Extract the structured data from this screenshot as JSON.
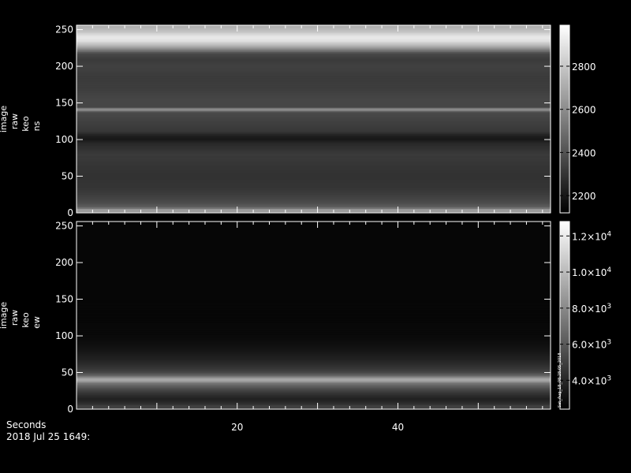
{
  "chart_data": [
    {
      "type": "heatmap",
      "name": "ns",
      "ylabel": [
        "image",
        "raw",
        "keo",
        "ns"
      ],
      "yticks": [
        0,
        50,
        100,
        150,
        200,
        250
      ],
      "ylim": [
        0,
        256
      ],
      "xlim": [
        0,
        59
      ],
      "colorbar": {
        "ticks": [
          2200,
          2400,
          2600,
          2800
        ],
        "tick_labels": [
          "2200",
          "2400",
          "2600",
          "2800"
        ],
        "range": [
          2120,
          2990
        ]
      },
      "row_profile": [
        [
          0,
          2540
        ],
        [
          4,
          2700
        ],
        [
          8,
          2450
        ],
        [
          14,
          2380
        ],
        [
          22,
          2340
        ],
        [
          35,
          2300
        ],
        [
          50,
          2290
        ],
        [
          65,
          2300
        ],
        [
          80,
          2320
        ],
        [
          95,
          2260
        ],
        [
          101,
          2200
        ],
        [
          106,
          2230
        ],
        [
          112,
          2310
        ],
        [
          125,
          2340
        ],
        [
          138,
          2370
        ],
        [
          142,
          2700
        ],
        [
          144,
          2360
        ],
        [
          155,
          2360
        ],
        [
          170,
          2330
        ],
        [
          185,
          2320
        ],
        [
          200,
          2340
        ],
        [
          210,
          2320
        ],
        [
          218,
          2370
        ],
        [
          222,
          2520
        ],
        [
          228,
          2720
        ],
        [
          235,
          2880
        ],
        [
          240,
          2920
        ],
        [
          244,
          2860
        ],
        [
          248,
          2780
        ],
        [
          252,
          2740
        ],
        [
          256,
          2700
        ]
      ]
    },
    {
      "type": "heatmap",
      "name": "ew",
      "ylabel": [
        "image",
        "raw",
        "keo",
        "ew"
      ],
      "yticks": [
        0,
        50,
        100,
        150,
        200,
        250
      ],
      "ylim": [
        0,
        256
      ],
      "xlim": [
        0,
        59
      ],
      "colorbar": {
        "ticks": [
          4000,
          6000,
          8000,
          10000,
          12000
        ],
        "tick_labels": [
          {
            "mant": "4.0",
            "exp": "3"
          },
          {
            "mant": "6.0",
            "exp": "3"
          },
          {
            "mant": "8.0",
            "exp": "3"
          },
          {
            "mant": "1.0",
            "exp": "4"
          },
          {
            "mant": "1.2",
            "exp": "4"
          }
        ],
        "range": [
          2400,
          12800
        ],
        "side_text": "Sat_Aug_18_08:28:05_2018"
      },
      "row_profile": [
        [
          0,
          4600
        ],
        [
          4,
          5200
        ],
        [
          8,
          4300
        ],
        [
          14,
          3700
        ],
        [
          20,
          4300
        ],
        [
          26,
          5100
        ],
        [
          32,
          6300
        ],
        [
          36,
          7200
        ],
        [
          40,
          9600
        ],
        [
          43,
          8600
        ],
        [
          46,
          6600
        ],
        [
          52,
          5000
        ],
        [
          60,
          4300
        ],
        [
          70,
          3700
        ],
        [
          80,
          3300
        ],
        [
          90,
          3000
        ],
        [
          100,
          2800
        ],
        [
          120,
          2700
        ],
        [
          160,
          2650
        ],
        [
          200,
          2650
        ],
        [
          256,
          2650
        ]
      ]
    }
  ],
  "xaxis": {
    "ticks": [
      20,
      40
    ],
    "tick_labels": [
      "20",
      "40"
    ],
    "label": "Seconds",
    "date_label": "2018 Jul 25 1649:"
  }
}
